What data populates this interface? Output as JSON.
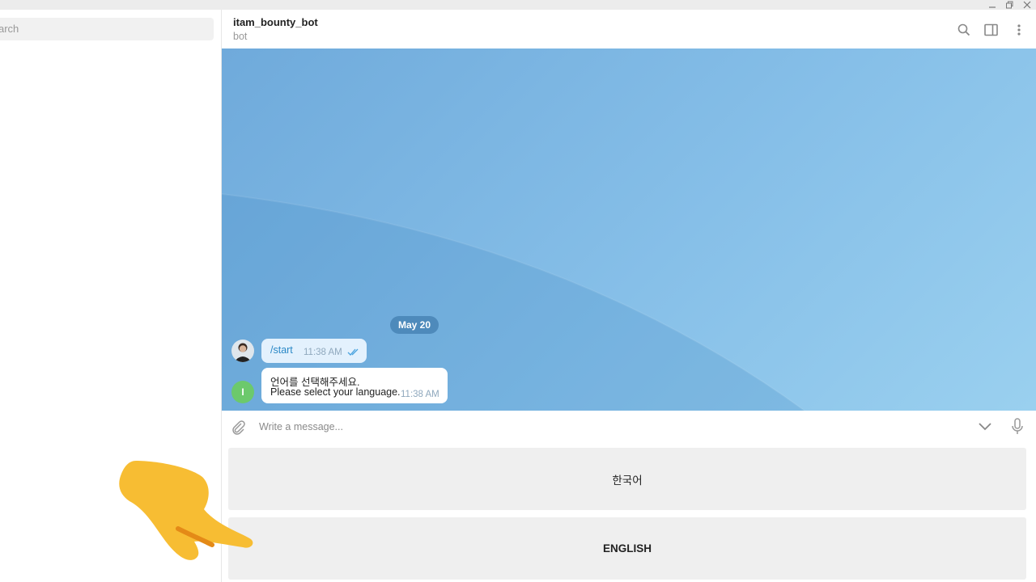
{
  "window": {
    "minimize_icon": "minimize-icon",
    "restore_icon": "restore-icon",
    "close_icon": "close-icon"
  },
  "sidebar": {
    "search_placeholder": "arch"
  },
  "header": {
    "title": "itam_bounty_bot",
    "subtitle": "bot",
    "icons": [
      "search-icon",
      "sidebar-toggle-icon",
      "more-vertical-icon"
    ]
  },
  "chat": {
    "date_label": "May 20",
    "messages": [
      {
        "direction": "outgoing",
        "text": "/start",
        "time": "11:38 AM",
        "status": "read"
      },
      {
        "direction": "incoming",
        "avatar_letter": "I",
        "lines": [
          "언어를 선택해주세요.",
          "Please select your language."
        ],
        "time": "11:38 AM"
      }
    ]
  },
  "composer": {
    "placeholder": "Write a message..."
  },
  "keyboard": {
    "buttons": [
      "한국어",
      "ENGLISH"
    ]
  },
  "colors": {
    "chat_bg": "#7db8e4",
    "accent": "#2a88c6",
    "incoming_avatar": "#6cc96c",
    "hand": "#f7bd33"
  }
}
